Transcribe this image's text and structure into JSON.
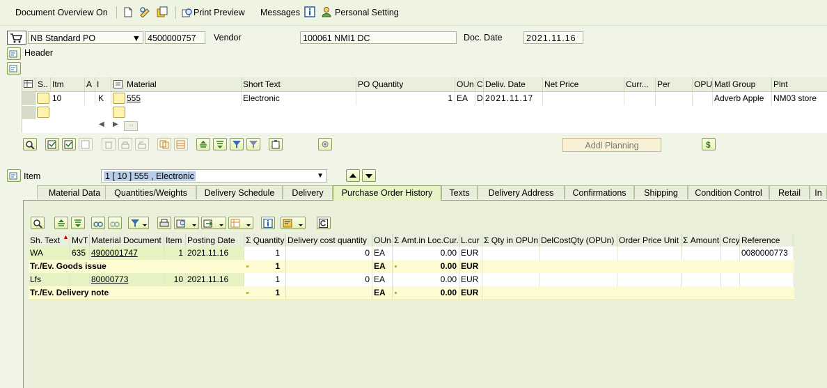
{
  "toolbar": {
    "document_overview": "Document Overview On",
    "print_preview": "Print Preview",
    "messages": "Messages",
    "personal_setting": "Personal Setting"
  },
  "header": {
    "doc_type": "NB Standard PO",
    "po_number": "4500000757",
    "vendor_label": "Vendor",
    "vendor_value": "100061 NMI1 DC",
    "doc_date_label": "Doc. Date",
    "doc_date_value": "2021.11.16",
    "header_label": "Header"
  },
  "items_grid": {
    "columns": [
      "S..",
      "Itm",
      "A",
      "I",
      "Material",
      "Short Text",
      "PO Quantity",
      "OUn",
      "C",
      "Deliv. Date",
      "Net Price",
      "Curr...",
      "Per",
      "OPU",
      "Matl Group",
      "Plnt"
    ],
    "rows": [
      {
        "itm": "10",
        "a": "",
        "i": "K",
        "material": "555",
        "short_text": "Electronic",
        "po_qty": "1",
        "oun": "EA",
        "c": "D",
        "deliv_date": "2021.11.17",
        "net_price": "",
        "curr": "",
        "per": "",
        "opu": "",
        "matl_group": "Adverb Apple",
        "plnt": "NM03 store"
      }
    ],
    "addl_planning": "Addl Planning"
  },
  "item_detail": {
    "item_label": "Item",
    "item_selected": "1 [ 10 ] 555 , Electronic",
    "tabs": [
      "Material Data",
      "Quantities/Weights",
      "Delivery Schedule",
      "Delivery",
      "Purchase Order History",
      "Texts",
      "Delivery Address",
      "Confirmations",
      "Shipping",
      "Condition Control",
      "Retail",
      "In"
    ],
    "active_tab": "Purchase Order History"
  },
  "history_grid": {
    "columns": [
      "Sh. Text",
      "MvT",
      "Material Document",
      "Item",
      "Posting Date",
      "Σ Quantity",
      "Delivery cost quantity",
      "OUn",
      "Σ Amt.in Loc.Cur.",
      "L.cur",
      "Σ Qty in OPUn",
      "DelCostQty (OPUn)",
      "Order Price Unit",
      "Σ Amount",
      "Crcy",
      "Reference"
    ],
    "rows": [
      {
        "sh_text": "WA",
        "mvt": "635",
        "mat_doc": "4900001747",
        "item": "1",
        "posting_date": "2021.11.16",
        "qty": "1",
        "del_cost_qty": "0",
        "oun": "EA",
        "amt": "0.00",
        "lcur": "EUR",
        "reference": "0080000773"
      },
      {
        "sum_label": "Tr./Ev. Goods issue",
        "qty": "1",
        "oun": "EA",
        "amt": "0.00",
        "lcur": "EUR"
      },
      {
        "sh_text": "Lfs",
        "mvt": "",
        "mat_doc": "80000773",
        "item": "10",
        "posting_date": "2021.11.16",
        "qty": "1",
        "del_cost_qty": "0",
        "oun": "EA",
        "amt": "0.00",
        "lcur": "EUR",
        "reference": ""
      },
      {
        "sum_label": "Tr./Ev. Delivery note",
        "qty": "1",
        "oun": "EA",
        "amt": "0.00",
        "lcur": "EUR"
      }
    ]
  }
}
